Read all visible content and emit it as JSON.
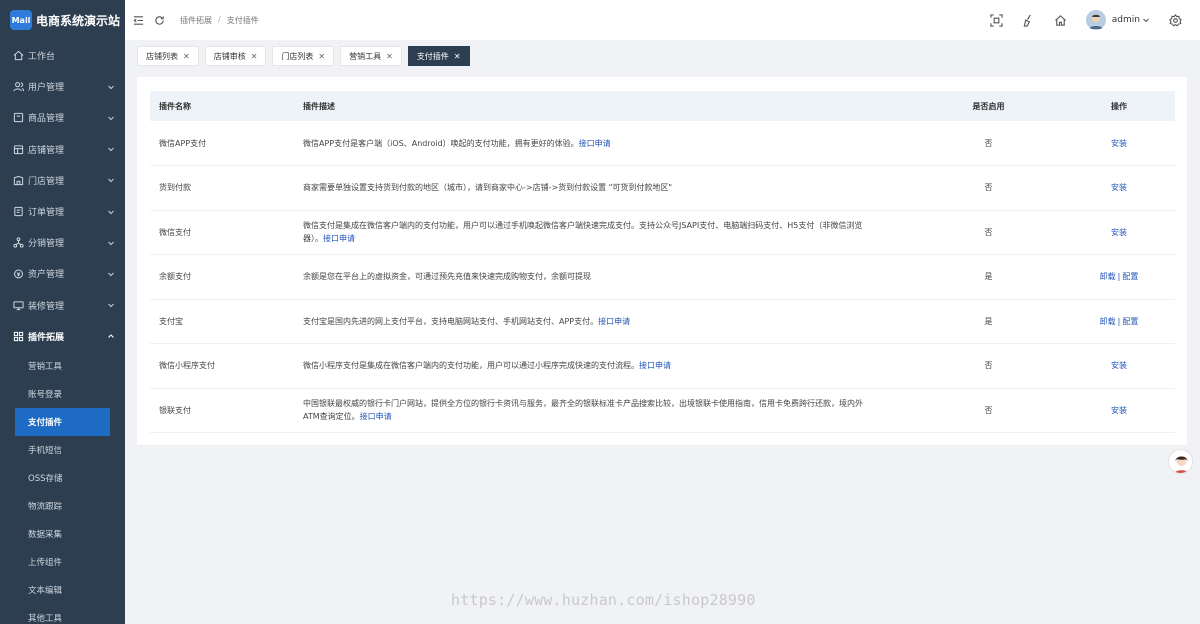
{
  "brand": {
    "logo": "Mall",
    "title": "电商系统演示站"
  },
  "sidebar": {
    "items": [
      {
        "label": "工作台",
        "icon": "home-icon",
        "has_children": false
      },
      {
        "label": "用户管理",
        "icon": "users-icon",
        "has_children": true
      },
      {
        "label": "商品管理",
        "icon": "box-icon",
        "has_children": true
      },
      {
        "label": "店铺管理",
        "icon": "store-icon",
        "has_children": true
      },
      {
        "label": "门店管理",
        "icon": "shop-icon",
        "has_children": true
      },
      {
        "label": "订单管理",
        "icon": "order-icon",
        "has_children": true
      },
      {
        "label": "分销管理",
        "icon": "share-icon",
        "has_children": true
      },
      {
        "label": "资产管理",
        "icon": "asset-icon",
        "has_children": true
      },
      {
        "label": "装修管理",
        "icon": "monitor-icon",
        "has_children": true
      },
      {
        "label": "插件拓展",
        "icon": "grid-icon",
        "has_children": true,
        "open": true
      }
    ],
    "sub_items": [
      {
        "label": "营销工具"
      },
      {
        "label": "账号登录"
      },
      {
        "label": "支付插件",
        "active": true
      },
      {
        "label": "手机短信"
      },
      {
        "label": "OSS存储"
      },
      {
        "label": "物流跟踪"
      },
      {
        "label": "数据采集"
      },
      {
        "label": "上传组件"
      },
      {
        "label": "文本编辑"
      },
      {
        "label": "其他工具"
      }
    ]
  },
  "header": {
    "breadcrumb": [
      "插件拓展",
      "支付插件"
    ],
    "user": "admin"
  },
  "tabs": [
    {
      "label": "店铺列表",
      "active": false
    },
    {
      "label": "店铺审核",
      "active": false
    },
    {
      "label": "门店列表",
      "active": false
    },
    {
      "label": "营销工具",
      "active": false
    },
    {
      "label": "支付插件",
      "active": true
    }
  ],
  "tab_close": "✕",
  "table": {
    "headers": {
      "name": "插件名称",
      "desc": "插件描述",
      "enabled": "是否启用",
      "ops": "操作"
    },
    "rows": [
      {
        "name": "微信APP支付",
        "desc": "微信APP支付是客户端（iOS、Android）唤起的支付功能，拥有更好的体验。",
        "link": "接口申请",
        "enabled": "否",
        "ops": [
          "安装"
        ]
      },
      {
        "name": "货到付款",
        "desc": "商家需要单独设置支持货到付款的地区（城市），请到商家中心->店铺->货到付款设置 \"可货到付款地区\"",
        "link": "",
        "enabled": "否",
        "ops": [
          "安装"
        ]
      },
      {
        "name": "微信支付",
        "desc": "微信支付是集成在微信客户端内的支付功能，用户可以通过手机唤起微信客户端快速完成支付。支持公众号JSAPI支付、电脑端扫码支付、H5支付（非微信浏览器）。",
        "link": "接口申请",
        "enabled": "否",
        "ops": [
          "安装"
        ]
      },
      {
        "name": "余额支付",
        "desc": "余额是您在平台上的虚拟资金，可通过预先充值来快速完成购物支付，余额可提现",
        "link": "",
        "enabled": "是",
        "ops": [
          "卸载",
          "配置"
        ]
      },
      {
        "name": "支付宝",
        "desc": "支付宝是国内先进的网上支付平台，支持电脑网站支付、手机网站支付、APP支付。",
        "link": "接口申请",
        "enabled": "是",
        "ops": [
          "卸载",
          "配置"
        ]
      },
      {
        "name": "微信小程序支付",
        "desc": "微信小程序支付是集成在微信客户端内的支付功能，用户可以通过小程序完成快速的支付流程。",
        "link": "接口申请",
        "enabled": "否",
        "ops": [
          "安装"
        ]
      },
      {
        "name": "银联支付",
        "desc": "中国银联最权威的银行卡门户网站，提供全方位的银行卡资讯与服务，最齐全的银联标准卡产品搜索比较，出境银联卡使用指南，信用卡免费跨行还款，境内外ATM查询定位。",
        "link": "接口申请",
        "enabled": "否",
        "ops": [
          "安装"
        ]
      }
    ]
  },
  "op_separator": "|",
  "watermark": "https://www.huzhan.com/ishop28990",
  "colors": {
    "sidebar_bg": "#2c3e50",
    "active_blue": "#1e6bc4",
    "link_blue": "#2355b8",
    "page_bg": "#f0f2f5"
  }
}
